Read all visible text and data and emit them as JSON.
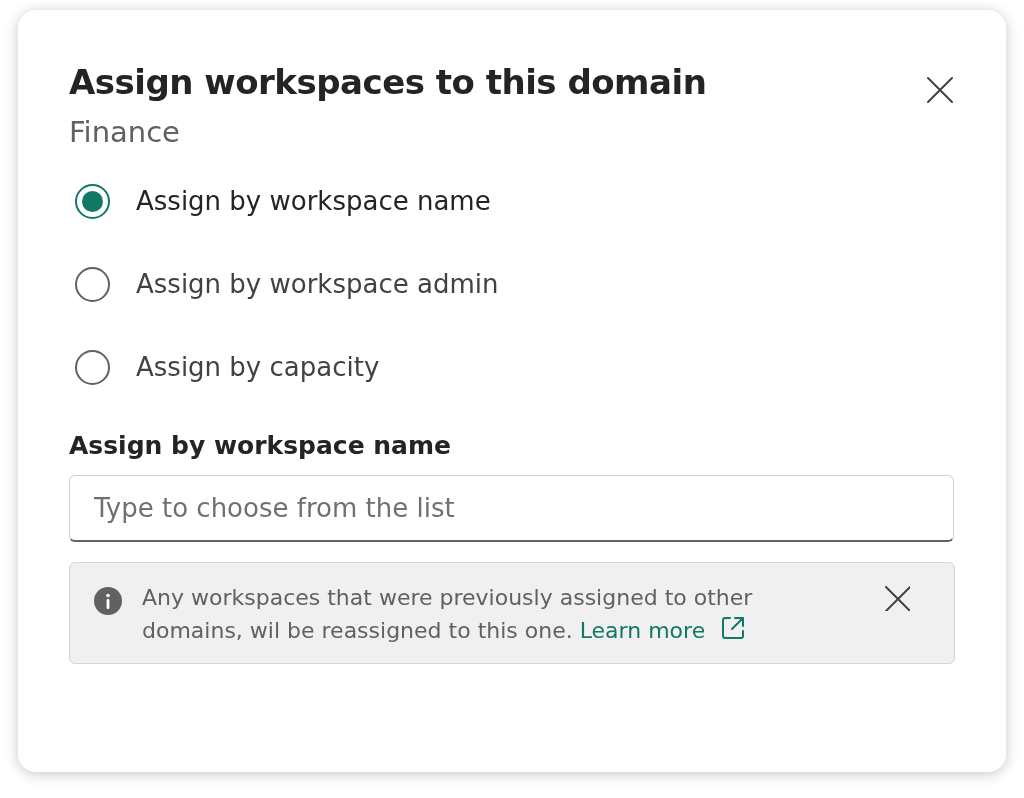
{
  "dialog": {
    "title": "Assign workspaces to this domain",
    "subtitle": "Finance"
  },
  "options": [
    {
      "label": "Assign by workspace name",
      "selected": true
    },
    {
      "label": "Assign by workspace admin",
      "selected": false
    },
    {
      "label": "Assign by capacity",
      "selected": false
    }
  ],
  "field": {
    "label": "Assign by workspace name",
    "placeholder": "Type to choose from the list"
  },
  "message": {
    "text": "Any workspaces that were previously assigned to other domains, wil be reassigned to this one.",
    "link": "Learn more"
  }
}
